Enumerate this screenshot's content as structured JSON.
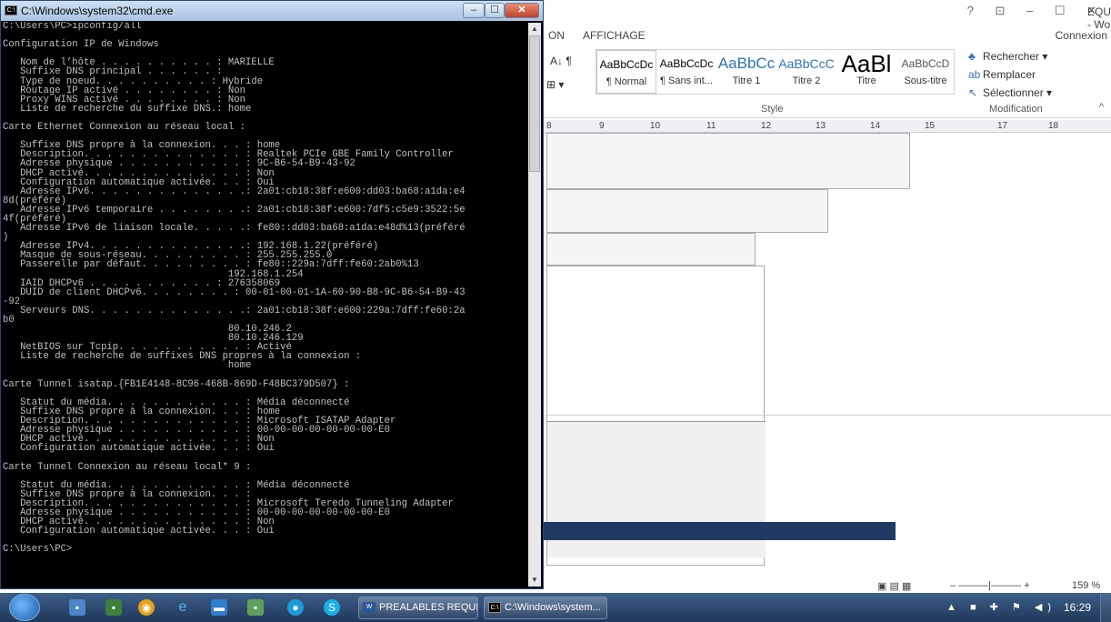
{
  "word": {
    "title": "EQUIS.docx - Word",
    "window_controls": "? ⊡ – ☐ ✕",
    "tabs": {
      "view": "ON",
      "display": "AFFICHAGE",
      "connect": "Connexion"
    },
    "styles": [
      {
        "preview": "AaBbCcDc",
        "name": "¶ Normal",
        "selected": true
      },
      {
        "preview": "AaBbCcDc",
        "name": "¶ Sans int..."
      },
      {
        "preview": "AaBbCc",
        "name": "Titre 1"
      },
      {
        "preview": "AaBbCcC",
        "name": "Titre 2"
      },
      {
        "preview": "AaBl",
        "name": "Titre"
      },
      {
        "preview": "AaBbCcD",
        "name": "Sous-titre"
      }
    ],
    "editing": {
      "find": "Rechercher",
      "replace": "Remplacer",
      "select": "Sélectionner"
    },
    "group_style": "Style",
    "group_edit": "Modification",
    "ruler_numbers": [
      "8",
      "9",
      "10",
      "11",
      "12",
      "13",
      "14",
      "15",
      "17",
      "18"
    ],
    "zoom": "159 %"
  },
  "cmd": {
    "title": "C:\\Windows\\system32\\cmd.exe",
    "lines": [
      "C:\\Users\\PC>ipconfig/all",
      "",
      "Configuration IP de Windows",
      "",
      "   Nom de l’hôte . . . . . . . . . . : MARIELLE",
      "   Suffixe DNS principal . . . . . . :",
      "   Type de noeud. . . . . . . . . . : Hybride",
      "   Routage IP activé . . . . . . . . : Non",
      "   Proxy WINS activé . . . . . . . . : Non",
      "   Liste de recherche du suffixe DNS.: home",
      "",
      "Carte Ethernet Connexion au réseau local :",
      "",
      "   Suffixe DNS propre à la connexion. . . : home",
      "   Description. . . . . . . . . . . . . . : Realtek PCIe GBE Family Controller",
      "   Adresse physique . . . . . . . . . . . : 9C-B6-54-B9-43-92",
      "   DHCP activé. . . . . . . . . . . . . . : Non",
      "   Configuration automatique activée. . . : Oui",
      "   Adresse IPv6. . . . . . . . . . . . . .: 2a01:cb18:38f:e600:dd03:ba68:a1da:e4",
      "8d(préféré)",
      "   Adresse IPv6 temporaire . . . . . . . .: 2a01:cb18:38f:e600:7df5:c5e9:3522:5e",
      "4f(préféré)",
      "   Adresse IPv6 de liaison locale. . . . .: fe80::dd03:ba68:a1da:e48d%13(préféré",
      ")",
      "   Adresse IPv4. . . . . . . . . . . . . .: 192.168.1.22(préféré)",
      "   Masque de sous-réseau. . . . . . . . . : 255.255.255.0",
      "   Passerelle par défaut. . . . . . . . . : fe80::229a:7dff:fe60:2ab0%13",
      "                                       192.168.1.254",
      "   IAID DHCPv6 . . . . . . . . . . . : 276358069",
      "   DUID de client DHCPv6. . . . . . . . : 00-01-00-01-1A-60-90-B8-9C-B6-54-B9-43",
      "-92",
      "   Serveurs DNS. . . . . . . . . . . . . .: 2a01:cb18:38f:e600:229a:7dff:fe60:2a",
      "b0",
      "                                       80.10.246.2",
      "                                       80.10.246.129",
      "   NetBIOS sur Tcpip. . . . . . . . . . . : Activé",
      "   Liste de recherche de suffixes DNS propres à la connexion :",
      "                                       home",
      "",
      "Carte Tunnel isatap.{FB1E4148-8C96-468B-869D-F48BC379D507} :",
      "",
      "   Statut du média. . . . . . . . . . . . : Média déconnecté",
      "   Suffixe DNS propre à la connexion. . . : home",
      "   Description. . . . . . . . . . . . . . : Microsoft ISATAP Adapter",
      "   Adresse physique . . . . . . . . . . . : 00-00-00-00-00-00-00-E0",
      "   DHCP activé. . . . . . . . . . . . . . : Non",
      "   Configuration automatique activée. . . : Oui",
      "",
      "Carte Tunnel Connexion au réseau local* 9 :",
      "",
      "   Statut du média. . . . . . . . . . . . : Média déconnecté",
      "   Suffixe DNS propre à la connexion. . . :",
      "   Description. . . . . . . . . . . . . . : Microsoft Teredo Tunneling Adapter",
      "   Adresse physique . . . . . . . . . . . : 00-00-00-00-00-00-00-E0",
      "   DHCP activé. . . . . . . . . . . . . . : Non",
      "   Configuration automatique activée. . . : Oui",
      "",
      "C:\\Users\\PC>"
    ]
  },
  "taskbar": {
    "task_word": "PREALABLES REQUIS...",
    "task_cmd": "C:\\Windows\\system...",
    "clock": "16:29"
  }
}
